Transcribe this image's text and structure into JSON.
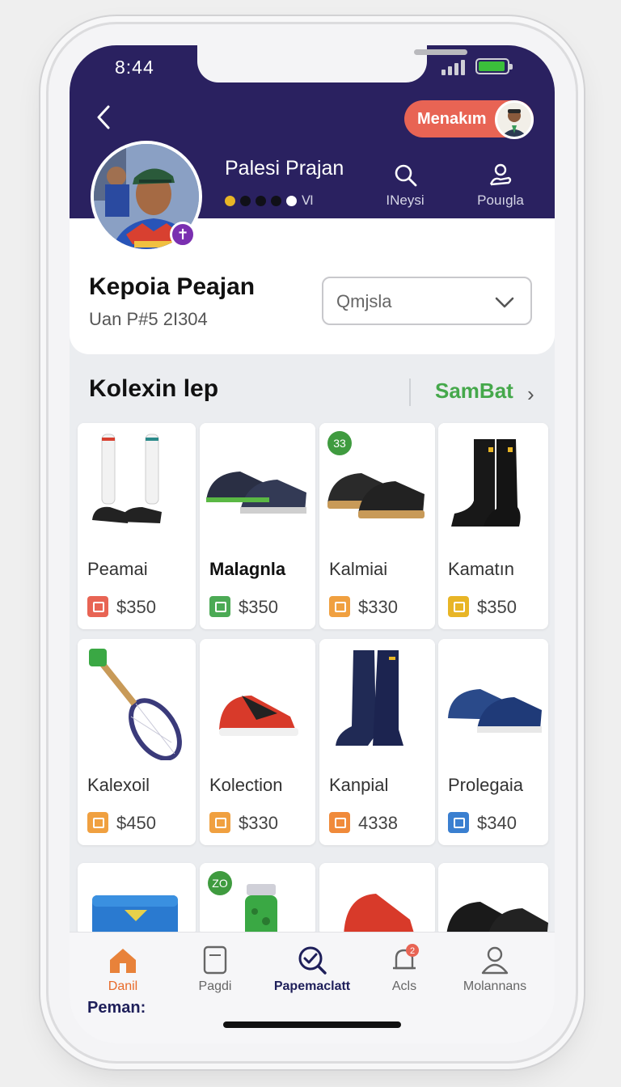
{
  "status_bar": {
    "time": "8:44"
  },
  "header": {
    "action_label": "Menakım",
    "profile_name": "Palesi Prajan",
    "nav": [
      {
        "label": "INeysi",
        "icon": "search-icon"
      },
      {
        "label": "Pouıgla",
        "icon": "user-hand-icon"
      }
    ],
    "rating_dots": [
      "#e8b526",
      "#101018",
      "#101018",
      "#101018",
      "#ffffff"
    ],
    "rating_symbol": "Ⅵ"
  },
  "profile": {
    "title": "Kepoia Peajan",
    "id_text": "Uan P#5 2I304",
    "select_value": "Qmjsla"
  },
  "section": {
    "title": "Kolexin lep",
    "link": "SamBat"
  },
  "products": [
    {
      "name": "Peamai",
      "price": "$350",
      "icon_color": "#e86454",
      "kind": "socks-cleats"
    },
    {
      "name": "Malagnla",
      "price": "$350",
      "icon_color": "#4caa55",
      "kind": "sneakers-navy",
      "bold": true
    },
    {
      "name": "Kalmiai",
      "price": "$330",
      "icon_color": "#f0a040",
      "kind": "sneakers-black-tan",
      "badge": "33"
    },
    {
      "name": "Kamatın",
      "price": "$350",
      "icon_color": "#e8b526",
      "kind": "boots-black"
    },
    {
      "name": "Kalexoil",
      "price": "$450",
      "icon_color": "#f0a040",
      "kind": "tennis-racket"
    },
    {
      "name": "Kolection",
      "price": "$330",
      "icon_color": "#f0a040",
      "kind": "sneakers-red"
    },
    {
      "name": "Kanpial",
      "price": "4338",
      "icon_color": "#f08a3a",
      "kind": "boots-navy"
    },
    {
      "name": "Prolegaia",
      "price": "$340",
      "icon_color": "#3a7fd0",
      "kind": "sneakers-blue"
    },
    {
      "name": "",
      "price": "",
      "icon_color": "#3a7fd0",
      "kind": "blue-box"
    },
    {
      "name": "",
      "price": "",
      "icon_color": "#3f9b3f",
      "kind": "jar",
      "badge": "ZO"
    },
    {
      "name": "",
      "price": "",
      "icon_color": "#e86454",
      "kind": "sneakers-red-partial"
    },
    {
      "name": "",
      "price": "",
      "icon_color": "#111111",
      "kind": "sneakers-black-partial"
    }
  ],
  "bottom_nav": [
    {
      "label": "Danil",
      "icon": "home-icon",
      "state": "home"
    },
    {
      "label": "Pagdi",
      "icon": "document-icon",
      "state": ""
    },
    {
      "label": "Papemaclatt",
      "icon": "search-check-icon",
      "state": "active"
    },
    {
      "label": "Acls",
      "icon": "bell-icon",
      "state": "",
      "badge": "2"
    },
    {
      "label": "Molannans",
      "icon": "profile-icon",
      "state": ""
    }
  ],
  "bottom_footer": "Peman:",
  "colors": {
    "header_bg": "#2a2160",
    "accent": "#e86454",
    "link": "#45a84b"
  }
}
